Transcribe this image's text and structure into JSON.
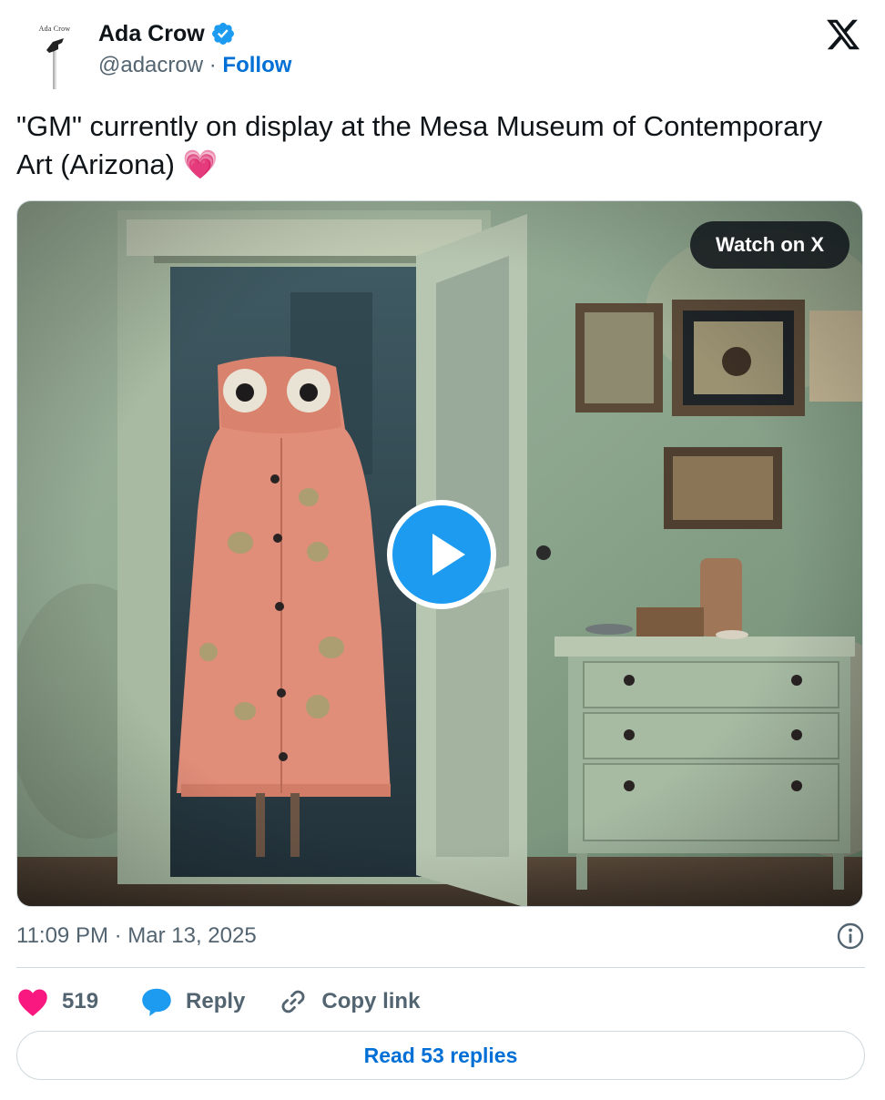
{
  "author": {
    "avatar_text": "Ada Crow",
    "name": "Ada Crow",
    "handle": "@adacrow",
    "separator": "·",
    "follow_label": "Follow"
  },
  "tweet": {
    "text": "\"GM\" currently on display at the Mesa Museum of Contemporary Art (Arizona)",
    "emoji": "💗"
  },
  "media": {
    "watch_label": "Watch on X"
  },
  "meta": {
    "timestamp": "11:09 PM · Mar 13, 2025"
  },
  "actions": {
    "like_count": "519",
    "reply_label": "Reply",
    "copy_label": "Copy link"
  },
  "footer": {
    "read_replies_label": "Read 53 replies"
  },
  "colors": {
    "accent": "#1d9bf0",
    "link": "#006fd6",
    "like": "#f91880",
    "secondary_text": "#536471"
  },
  "icons": [
    "verified-badge-icon",
    "x-logo-icon",
    "play-icon",
    "info-icon",
    "heart-icon",
    "reply-bubble-icon",
    "link-icon"
  ]
}
